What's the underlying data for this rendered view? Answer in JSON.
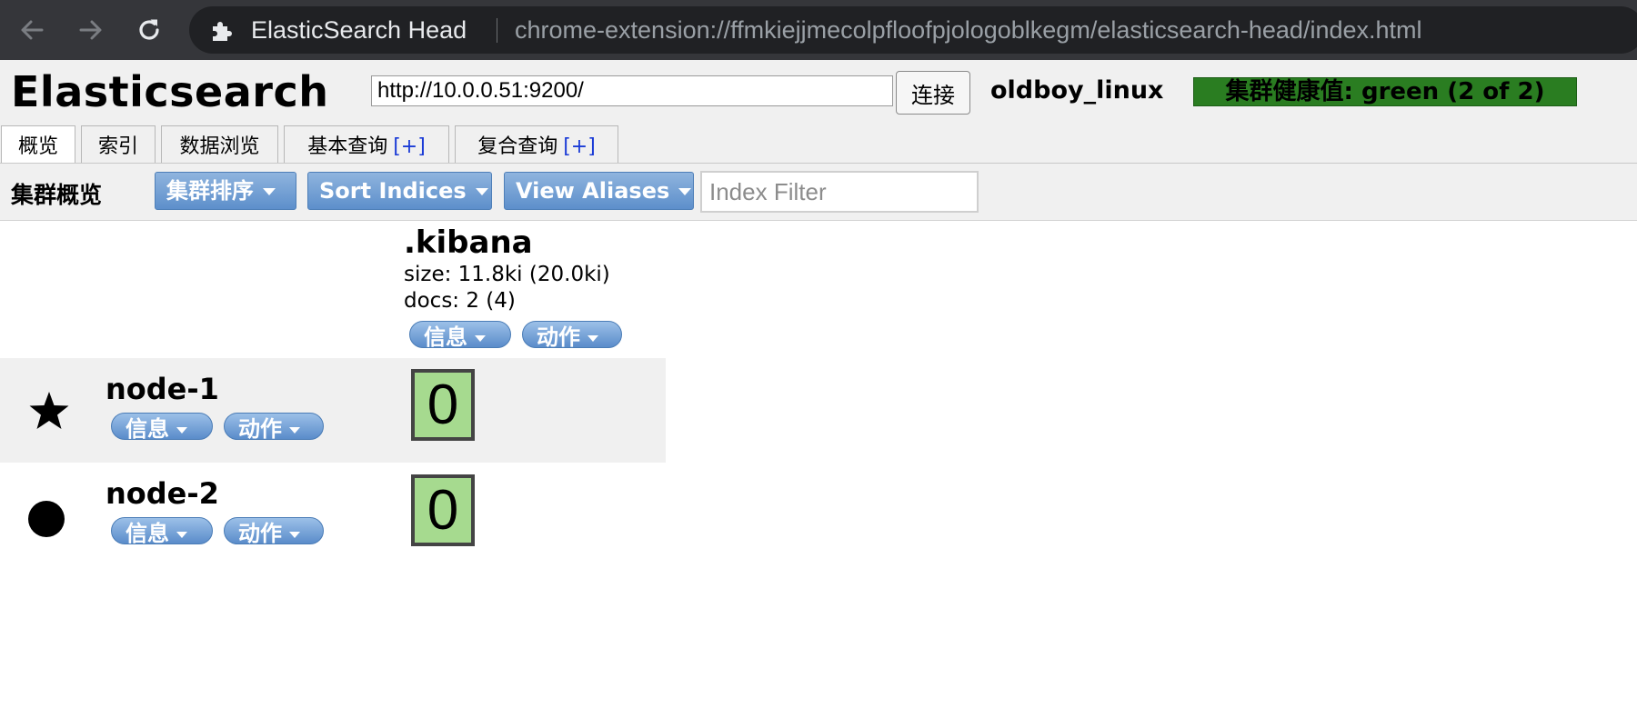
{
  "browser": {
    "back_icon": "arrow-left-icon",
    "forward_icon": "arrow-right-icon",
    "reload_icon": "reload-icon",
    "extension_icon": "puzzle-icon",
    "extension_name": "ElasticSearch Head",
    "url": "chrome-extension://ffmkiejjmecolpfloofpjologoblkegm/elasticsearch-head/index.html"
  },
  "header": {
    "brand": "Elasticsearch",
    "connection_url": "http://10.0.0.51:9200/",
    "connect_label": "连接",
    "cluster_name": "oldboy_linux",
    "health": "集群健康值: green (2 of 2)",
    "health_color": "#2a7d21"
  },
  "tabs": [
    {
      "label": "概览",
      "plus": ""
    },
    {
      "label": "索引",
      "plus": ""
    },
    {
      "label": "数据浏览",
      "plus": ""
    },
    {
      "label": "基本查询",
      "plus": "[+]"
    },
    {
      "label": "复合查询",
      "plus": "[+]"
    }
  ],
  "toolbar": {
    "title": "集群概览",
    "cluster_sort_label": "集群排序",
    "sort_indices_label": "Sort Indices",
    "view_aliases_label": "View Aliases",
    "index_filter_placeholder": "Index Filter"
  },
  "index": {
    "name": ".kibana",
    "size": "size: 11.8ki (20.0ki)",
    "docs": "docs: 2 (4)",
    "info_label": "信息",
    "action_label": "动作"
  },
  "nodes": [
    {
      "name": "node-1",
      "icon": "star-icon",
      "info_label": "信息",
      "action_label": "动作",
      "shard": "0"
    },
    {
      "name": "node-2",
      "icon": "circle-icon",
      "info_label": "信息",
      "action_label": "动作",
      "shard": "0"
    }
  ],
  "colors": {
    "button_blue": "#5d8fcb",
    "shard_green": "#a6da8f"
  }
}
